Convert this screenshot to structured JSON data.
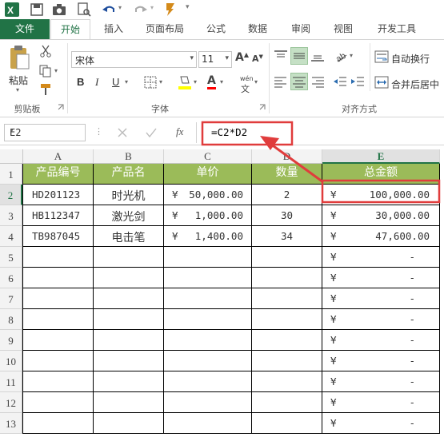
{
  "ribbon_tabs": [
    "文件",
    "开始",
    "插入",
    "页面布局",
    "公式",
    "数据",
    "审阅",
    "视图",
    "开发工具"
  ],
  "clipboard": {
    "paste": "粘贴",
    "group": "剪贴板"
  },
  "font": {
    "name": "宋体",
    "size": "11",
    "bold": "B",
    "italic": "I",
    "underline": "U",
    "font_color_glyph": "A",
    "pinyin_glyph": "wén",
    "group": "字体"
  },
  "alignment": {
    "wrap": "自动换行",
    "merge": "合并后居中",
    "group": "对齐方式"
  },
  "formula_bar": {
    "name_box": "E2",
    "fx": "fx",
    "formula": "=C2*D2"
  },
  "columns": [
    "A",
    "B",
    "C",
    "D",
    "E"
  ],
  "rows": [
    "1",
    "2",
    "3",
    "4",
    "5",
    "6",
    "7",
    "8",
    "9",
    "10",
    "11",
    "12",
    "13"
  ],
  "headers": [
    "产品编号",
    "产品名",
    "单价",
    "数量",
    "总金额"
  ],
  "data_rows": [
    {
      "code": "HD201123",
      "name": "时光机",
      "price": "50,000.00",
      "qty": "2",
      "total": "100,000.00"
    },
    {
      "code": "HB112347",
      "name": "激光剑",
      "price": "1,000.00",
      "qty": "30",
      "total": "30,000.00"
    },
    {
      "code": "TB987045",
      "name": "电击笔",
      "price": "1,400.00",
      "qty": "34",
      "total": "47,600.00"
    }
  ],
  "currency": "¥",
  "empty_total": "-",
  "colors": {
    "file_tab": "#217346",
    "header_fill": "#9bbb59",
    "callout": "#e03c3c"
  }
}
